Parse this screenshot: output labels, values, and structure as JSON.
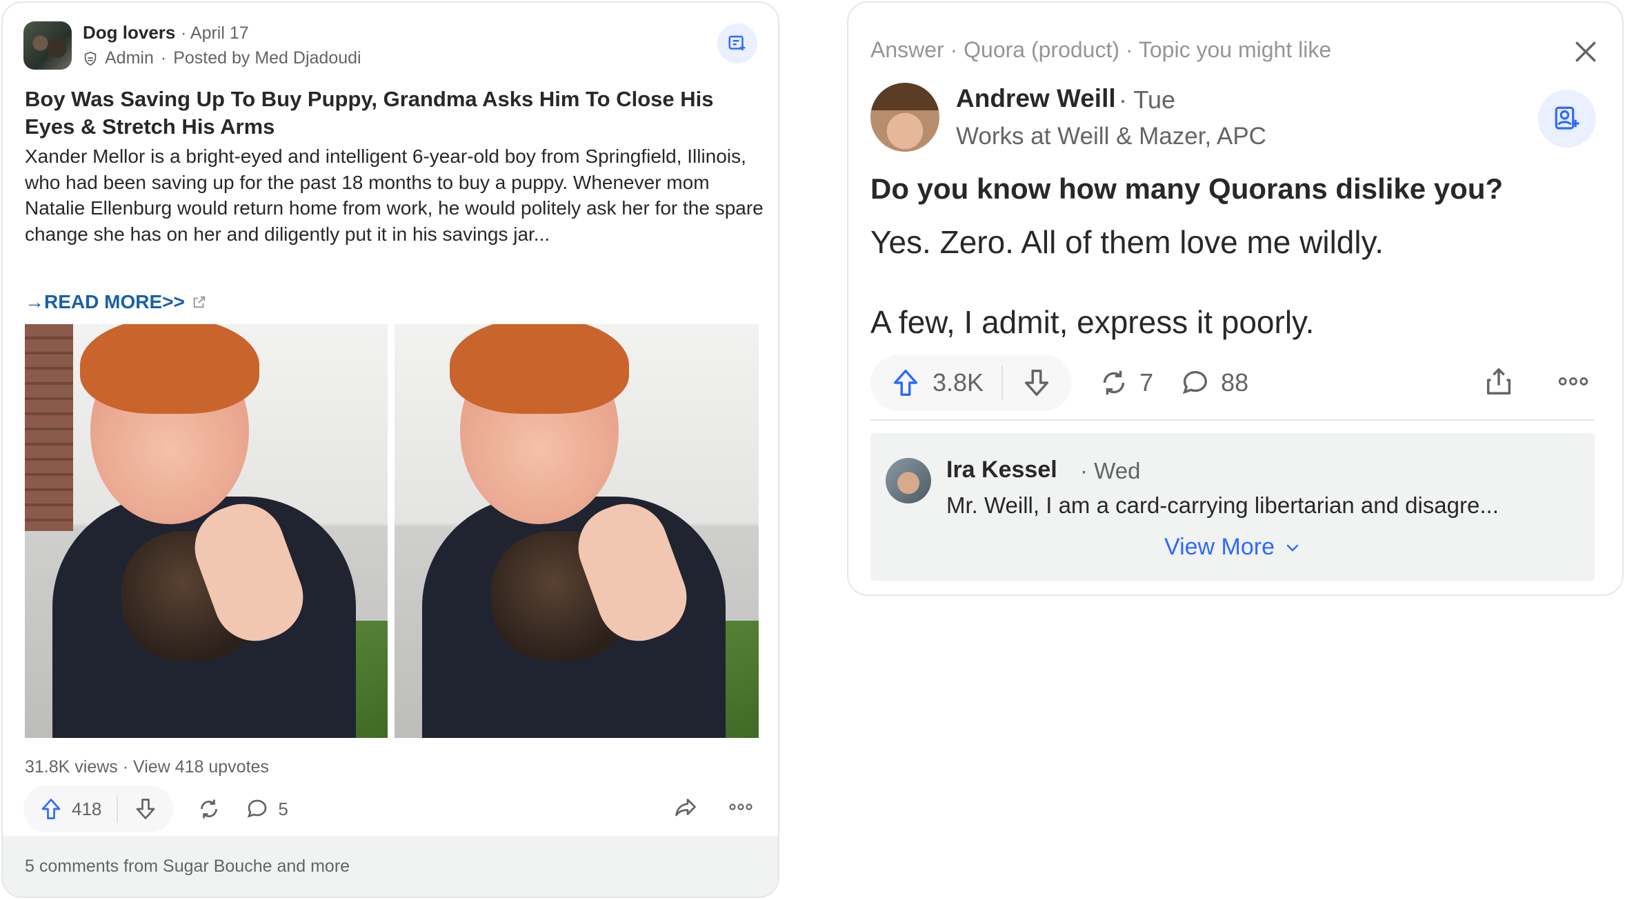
{
  "left_post": {
    "space_name": "Dog lovers",
    "date": "April 17",
    "admin_label": "Admin",
    "posted_by": "Posted by Med Djadoudi",
    "title": "Boy Was Saving Up To Buy Puppy, Grandma Asks Him To Close His Eyes & Stretch His Arms",
    "body": "Xander Mellor is a bright-eyed and intelligent 6-year-old boy from Springfield, Illinois, who had been saving up for the past 18 months to buy a puppy. Whenever mom Natalie Ellenburg would return home from work, he would politely ask her for the spare change she has on her and diligently put it in his savings jar...",
    "read_more": "READ MORE>>",
    "views": "31.8K views",
    "upvotes_link": "View 418 upvotes",
    "upvote_count": "418",
    "comment_count": "5",
    "footer": "5 comments from Sugar Bouche and more"
  },
  "right_post": {
    "context_type": "Answer",
    "context_space": "Quora (product)",
    "context_reason": "Topic you might like",
    "author": "Andrew Weill",
    "when": "Tue",
    "credential": "Works at Weill & Mazer, APC",
    "question": "Do you know how many Quorans dislike you?",
    "answer_line1": "Yes. Zero. All of them love me wildly.",
    "answer_line2": "A few, I admit, express it poorly.",
    "upvote_count": "3.8K",
    "share_count": "7",
    "comment_count": "88",
    "comment": {
      "author": "Ira Kessel",
      "when": "Wed",
      "text": "Mr. Weill, I am a card-carrying libertarian and disagre...",
      "view_more": "View More"
    }
  },
  "colors": {
    "accent": "#2e69ff",
    "text_primary": "#282829",
    "text_secondary": "#636466",
    "follow_bg": "#ebf0ff"
  }
}
